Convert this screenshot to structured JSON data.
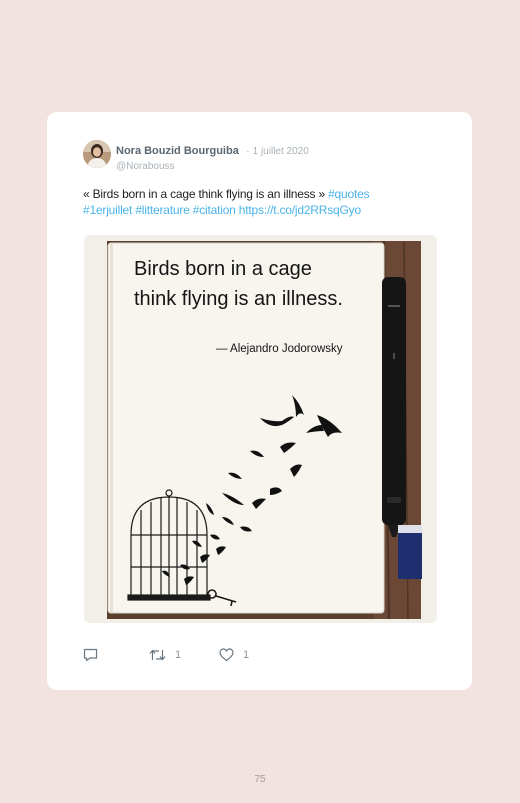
{
  "tweet": {
    "author_name": "Nora Bouzid Bourguiba",
    "separator": "·",
    "date": "1 juillet 2020",
    "handle": "@Norabouss",
    "text_plain": "« Birds born in a cage think flying is an illness » ",
    "hashtag_quotes": "#quotes",
    "hashtag_1erjuillet": "#1erjuillet",
    "hashtag_litterature": "#litterature",
    "hashtag_citation": "#citation",
    "url": "https://t.co/jd2RRsqGyo",
    "image_quote_line1": "Birds born in a cage",
    "image_quote_line2": "think flying is an illness.",
    "image_attribution": "— Alejandro Jodorowsky",
    "retweet_count": "1",
    "like_count": "1"
  },
  "page": {
    "number": "75"
  },
  "icons": {
    "reply": "reply-icon",
    "retweet": "retweet-icon",
    "like": "heart-icon"
  },
  "colors": {
    "background": "#f3e3e0",
    "link": "#4ab3e8",
    "name": "#5a6670",
    "muted": "#a9b2b8"
  }
}
